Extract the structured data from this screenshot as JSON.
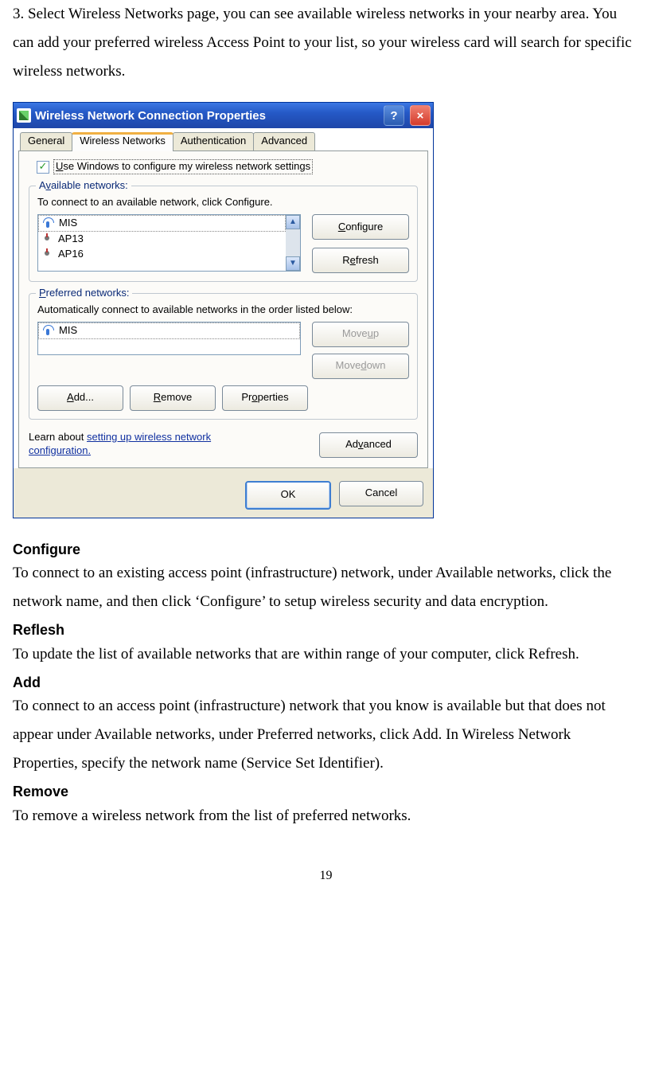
{
  "intro": "3. Select Wireless Networks page, you can see available wireless networks in your nearby area. You can add your preferred wireless Access Point to your list, so your wireless card will search for specific wireless networks.",
  "dialog": {
    "title": "Wireless Network Connection Properties",
    "help": "?",
    "close": "×",
    "tabs": {
      "general": "General",
      "wireless": "Wireless Networks",
      "auth": "Authentication",
      "advanced": "Advanced"
    },
    "checkbox": {
      "u": "U",
      "rest": "se Windows to configure my wireless network settings"
    },
    "available": {
      "legend_a": "A",
      "legend_v": "v",
      "legend_rest": "ailable networks:",
      "intro": "To connect to an available network, click Configure.",
      "items": {
        "0": "MIS",
        "1": "AP13",
        "2": "AP16"
      },
      "configure_c": "C",
      "configure_rest": "onfigure",
      "refresh_r": "R",
      "refresh_e": "e",
      "refresh_rest": "fresh",
      "up": "▲",
      "down": "▼"
    },
    "preferred": {
      "legend_p": "P",
      "legend_rest": "referred networks:",
      "intro": "Automatically connect to available networks in the order listed below:",
      "items": {
        "0": "MIS"
      },
      "moveup_pre": "Move ",
      "moveup_u": "u",
      "moveup_post": "p",
      "movedown_pre": "Move ",
      "movedown_d": "d",
      "movedown_post": "own",
      "add_a": "A",
      "add_rest": "dd...",
      "remove_r": "R",
      "remove_rest": "emove",
      "props_pre": "Pr",
      "props_o": "o",
      "props_post": "perties"
    },
    "learn": {
      "pre": "Learn about ",
      "link": "setting up wireless network configuration."
    },
    "adv_pre": "Ad",
    "adv_v": "v",
    "adv_post": "anced",
    "ok": "OK",
    "cancel": "Cancel"
  },
  "sections": {
    "configure": {
      "title": "Configure",
      "body": "To connect to an existing access point (infrastructure) network, under Available networks, click the network name, and then click ‘Configure’ to setup wireless security and data encryption."
    },
    "reflesh": {
      "title": "Reflesh",
      "body": "To update the list of available networks that are within range of your computer, click Refresh."
    },
    "add": {
      "title": "Add",
      "body": "To connect to an access point (infrastructure) network that you know is available but that does not appear under Available networks, under Preferred networks, click Add. In Wireless Network Properties, specify the network name (Service Set Identifier)."
    },
    "remove": {
      "title": "Remove",
      "body": "To remove a wireless network from the list of preferred networks."
    }
  },
  "pageNum": "19"
}
